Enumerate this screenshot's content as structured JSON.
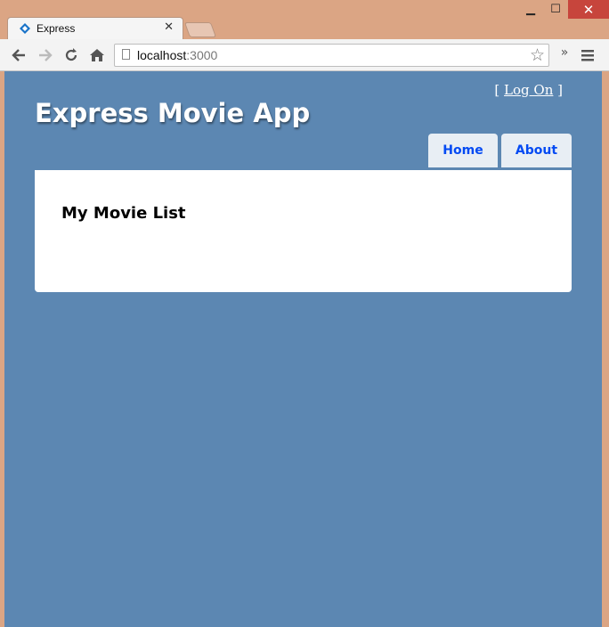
{
  "browser": {
    "tab_title": "Express",
    "url_host": "localhost",
    "url_port": ":3000",
    "window_controls": {
      "minimize": "▁",
      "maximize": "☐",
      "close": "✕"
    }
  },
  "toolbar": {
    "back_icon": "back-arrow-icon",
    "forward_icon": "forward-arrow-icon",
    "reload_icon": "reload-icon",
    "home_icon": "home-icon",
    "extensions_label": "»",
    "menu_icon": "menu-icon"
  },
  "header": {
    "login_open": "[ ",
    "login_link": "Log On",
    "login_close": " ]",
    "site_title": "Express Movie App"
  },
  "menu": {
    "items": [
      {
        "label": "Home"
      },
      {
        "label": "About"
      }
    ]
  },
  "main": {
    "heading": "My Movie List"
  },
  "colors": {
    "page_bg": "#5c87b2",
    "menu_tab_bg": "#e8eef4",
    "menu_link": "#034af3",
    "frame": "#dba584"
  }
}
